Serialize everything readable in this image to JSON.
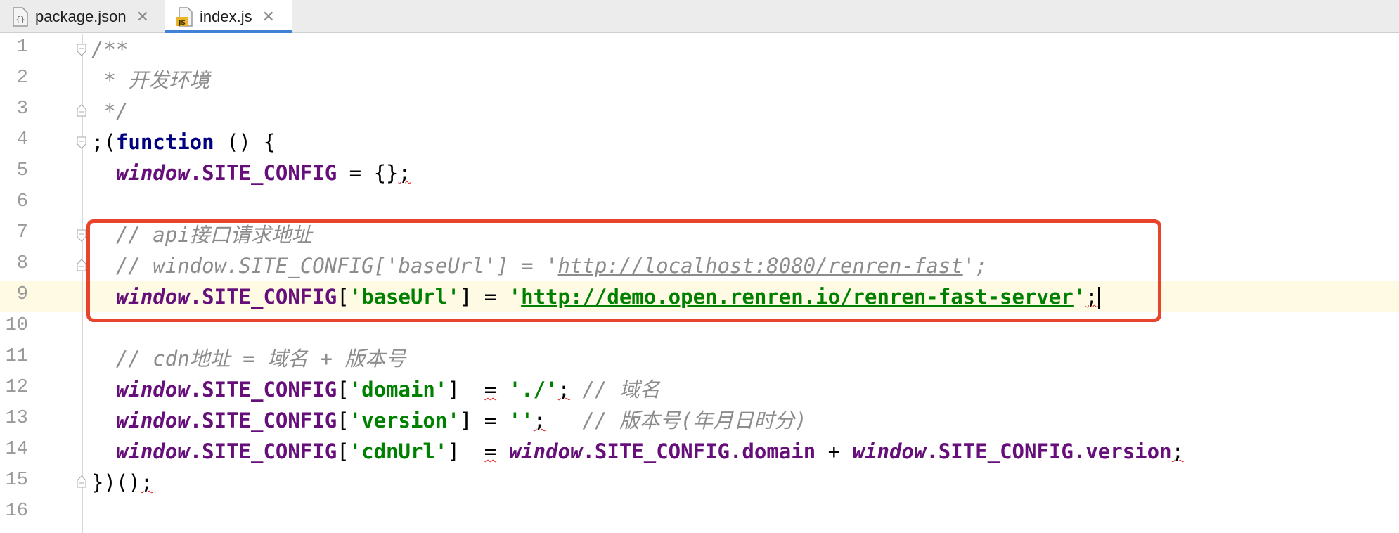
{
  "tabs": [
    {
      "label": "package.json",
      "icon": "json-file-icon",
      "active": false
    },
    {
      "label": "index.js",
      "icon": "js-file-icon",
      "active": true,
      "badge": "JS"
    }
  ],
  "line_numbers": [
    "1",
    "2",
    "3",
    "4",
    "5",
    "6",
    "7",
    "8",
    "9",
    "10",
    "11",
    "12",
    "13",
    "14",
    "15",
    "16"
  ],
  "code": {
    "l1": "/**",
    "l2": " * 开发环境",
    "l3": " */",
    "l4a": ";(",
    "l4kw": "function",
    "l4b": " () {",
    "win": "window",
    "sc": ".SITE_CONFIG",
    "l5b": " = {}",
    "semi": ";",
    "l7": "// api接口请求地址",
    "l8a": "// window.SITE_CONFIG['baseUrl'] = '",
    "l8url": "http://localhost:8080/renren-fast",
    "l8b": "';",
    "br_open": "[",
    "br_close": "]",
    "q": "'",
    "baseUrl_key": "'baseUrl'",
    "eq": " = ",
    "l9url": "http://demo.open.renren.io/renren-fast-server",
    "l11": "// cdn地址 = 域名 + 版本号",
    "domain_key": "'domain'",
    "l12pad": "  ",
    "l12eq": "=",
    "l12val": "'./'",
    "l12c": " // 域名",
    "version_key": "'version'",
    "l13val": "''",
    "l13c": "   // 版本号(年月日时分)",
    "cdnUrl_key": "'cdnUrl'",
    "l14d": ".domain",
    "plus": " + ",
    "l14v": ".version",
    "l15": "})()"
  },
  "colors": {
    "highlight_box": "#e8442c",
    "keyword": "#000080",
    "global": "#660e7a",
    "string": "#008000",
    "comment": "#8c8c8c",
    "current_line": "#fffae3",
    "active_tab_underline": "#3f82d6"
  }
}
